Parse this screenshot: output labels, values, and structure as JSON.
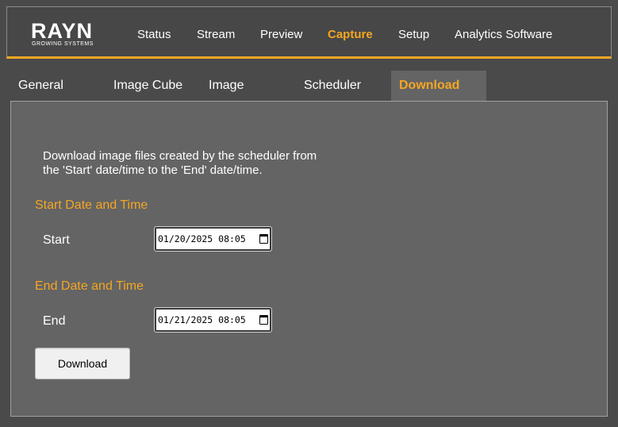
{
  "brand": {
    "name": "RAYN",
    "tagline": "GROWING SYSTEMS",
    "accent_color": "#f5a623"
  },
  "nav": {
    "items": [
      {
        "label": "Status",
        "active": false
      },
      {
        "label": "Stream",
        "active": false
      },
      {
        "label": "Preview",
        "active": false
      },
      {
        "label": "Capture",
        "active": true
      },
      {
        "label": "Setup",
        "active": false
      },
      {
        "label": "Analytics Software",
        "active": false
      }
    ]
  },
  "tabs": [
    {
      "label": "General",
      "active": false
    },
    {
      "label": "Image Cube",
      "active": false
    },
    {
      "label": "Image",
      "active": false
    },
    {
      "label": "Scheduler",
      "active": false
    },
    {
      "label": "Download",
      "active": true
    }
  ],
  "panel": {
    "description_line1": "Download image files created by the scheduler from",
    "description_line2": "the 'Start' date/time to the 'End' date/time.",
    "start_section_title": "Start Date and Time",
    "start_label": "Start",
    "start_value": "01/20/2025 08:05",
    "end_section_title": "End Date and Time",
    "end_label": "End",
    "end_value": "01/21/2025 08:05",
    "download_button": "Download"
  }
}
